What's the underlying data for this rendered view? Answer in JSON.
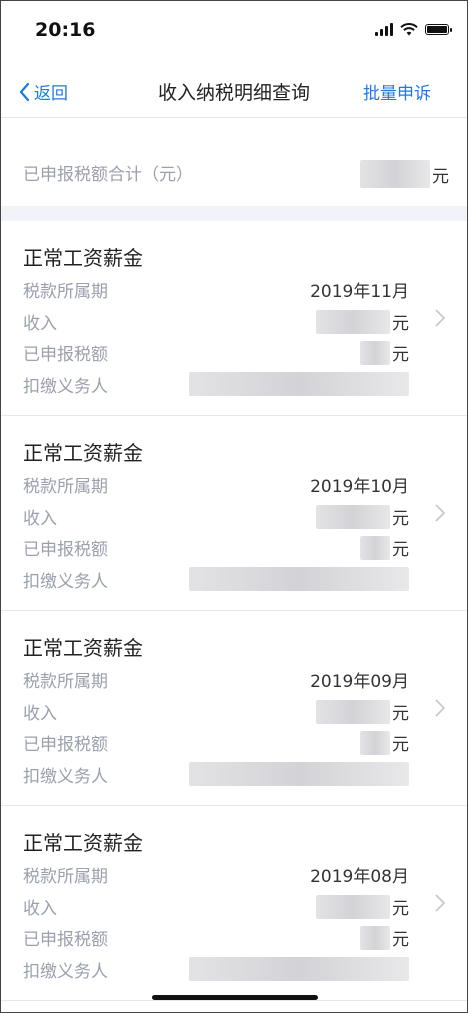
{
  "status": {
    "time": "20:16"
  },
  "nav": {
    "back_label": "返回",
    "title": "收入纳税明细查询",
    "action_label": "批量申诉"
  },
  "summary": {
    "label": "已申报税额合计（元）",
    "unit": "元"
  },
  "labels": {
    "period": "税款所属期",
    "income": "收入",
    "tax": "已申报税额",
    "withholder": "扣缴义务人",
    "unit": "元"
  },
  "records": [
    {
      "type": "正常工资薪金",
      "period": "2019年11月"
    },
    {
      "type": "正常工资薪金",
      "period": "2019年10月"
    },
    {
      "type": "正常工资薪金",
      "period": "2019年09月"
    },
    {
      "type": "正常工资薪金",
      "period": "2019年08月"
    }
  ]
}
